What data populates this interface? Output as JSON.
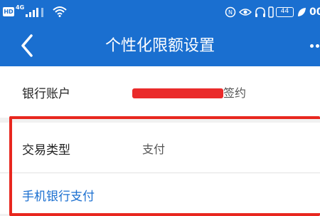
{
  "status_bar": {
    "hd_badge": "HD",
    "network": "4G",
    "battery": "44",
    "time": "00"
  },
  "nav": {
    "title": "个性化限额设置"
  },
  "account": {
    "label": "银行账户",
    "status": "签约"
  },
  "transaction": {
    "label": "交易类型",
    "value": "支付"
  },
  "mobile_banking": {
    "label": "手机银行支付"
  },
  "colors": {
    "primary": "#1a6fd0",
    "highlight": "#e8271f",
    "redaction": "#ea2b2b"
  }
}
